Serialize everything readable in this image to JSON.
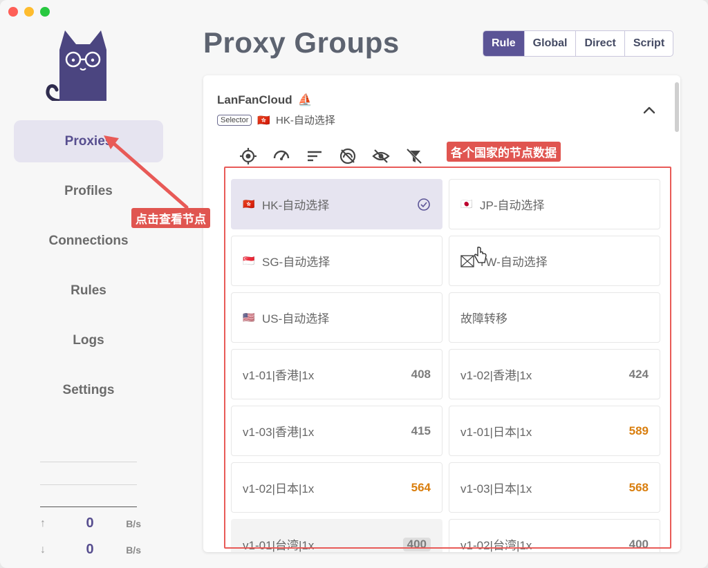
{
  "sidebar": {
    "items": [
      {
        "label": "Proxies",
        "active": true
      },
      {
        "label": "Profiles",
        "active": false
      },
      {
        "label": "Connections",
        "active": false
      },
      {
        "label": "Rules",
        "active": false
      },
      {
        "label": "Logs",
        "active": false
      },
      {
        "label": "Settings",
        "active": false
      }
    ],
    "traffic": {
      "up_value": "0",
      "up_unit": "B/s",
      "down_value": "0",
      "down_unit": "B/s"
    }
  },
  "main": {
    "title": "Proxy Groups",
    "modes": [
      {
        "label": "Rule",
        "active": true
      },
      {
        "label": "Global",
        "active": false
      },
      {
        "label": "Direct",
        "active": false
      },
      {
        "label": "Script",
        "active": false
      }
    ],
    "group": {
      "name": "LanFanCloud",
      "name_emoji": "⛵",
      "type_badge": "Selector",
      "current_flag": "🇭🇰",
      "current": "HK-自动选择"
    },
    "toolbar_icons": [
      "target-icon",
      "speed-test-icon",
      "sort-icon",
      "hide-unavailable-icon",
      "hide-icon",
      "filter-off-icon"
    ],
    "nodes": [
      {
        "flag": "🇭🇰",
        "name": "HK-自动选择",
        "delay": "",
        "selected": true
      },
      {
        "flag": "🇯🇵",
        "name": "JP-自动选择",
        "delay": ""
      },
      {
        "flag": "🇸🇬",
        "name": "SG-自动选择",
        "delay": ""
      },
      {
        "flag": "",
        "name": "TW-自动选择",
        "delay": "",
        "broken_flag": true
      },
      {
        "flag": "🇺🇸",
        "name": "US-自动选择",
        "delay": ""
      },
      {
        "flag": "",
        "name": "故障转移",
        "delay": ""
      },
      {
        "flag": "",
        "name": "v1-01|香港|1x",
        "delay": "408"
      },
      {
        "flag": "",
        "name": "v1-02|香港|1x",
        "delay": "424"
      },
      {
        "flag": "",
        "name": "v1-03|香港|1x",
        "delay": "415"
      },
      {
        "flag": "",
        "name": "v1-01|日本|1x",
        "delay": "589",
        "slow": true
      },
      {
        "flag": "",
        "name": "v1-02|日本|1x",
        "delay": "564",
        "slow": true
      },
      {
        "flag": "",
        "name": "v1-03|日本|1x",
        "delay": "568",
        "slow": true
      },
      {
        "flag": "",
        "name": "v1-01|台湾|1x",
        "delay": "400",
        "hover": true
      },
      {
        "flag": "",
        "name": "v1-02|台湾|1x",
        "delay": "400"
      }
    ],
    "colors": {
      "accent": "#5b5496",
      "slow": "#d97e0e",
      "annotation": "#e05550"
    }
  },
  "annotations": {
    "click_hint": "点击查看节点",
    "nodes_hint": "各个国家的节点数据"
  }
}
